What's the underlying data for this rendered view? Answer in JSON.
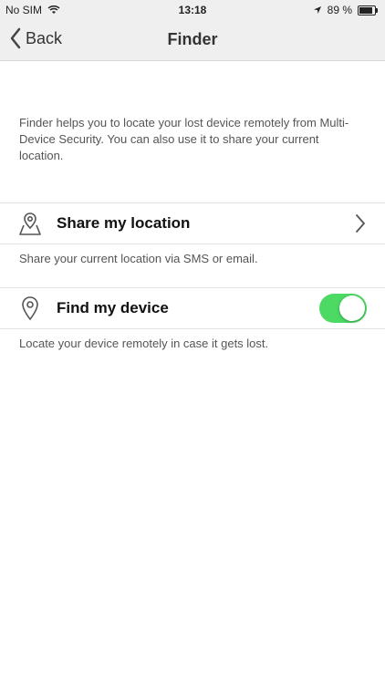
{
  "status_bar": {
    "carrier": "No SIM",
    "time": "13:18",
    "battery_percent": "89 %",
    "battery_level": 0.89
  },
  "nav": {
    "back_label": "Back",
    "title": "Finder"
  },
  "intro_text": "Finder helps you to locate your lost device remotely from Multi-Device Security. You can also use it to share your current location.",
  "rows": {
    "share": {
      "label": "Share my location",
      "description": "Share your current location via SMS or email.",
      "icon": "map-pin-icon"
    },
    "find": {
      "label": "Find my device",
      "description": "Locate your device remotely in case it gets lost.",
      "icon": "location-pin-icon",
      "toggle_on": true
    }
  },
  "colors": {
    "toggle_on": "#4cd964",
    "bar_bg": "#efefef"
  }
}
